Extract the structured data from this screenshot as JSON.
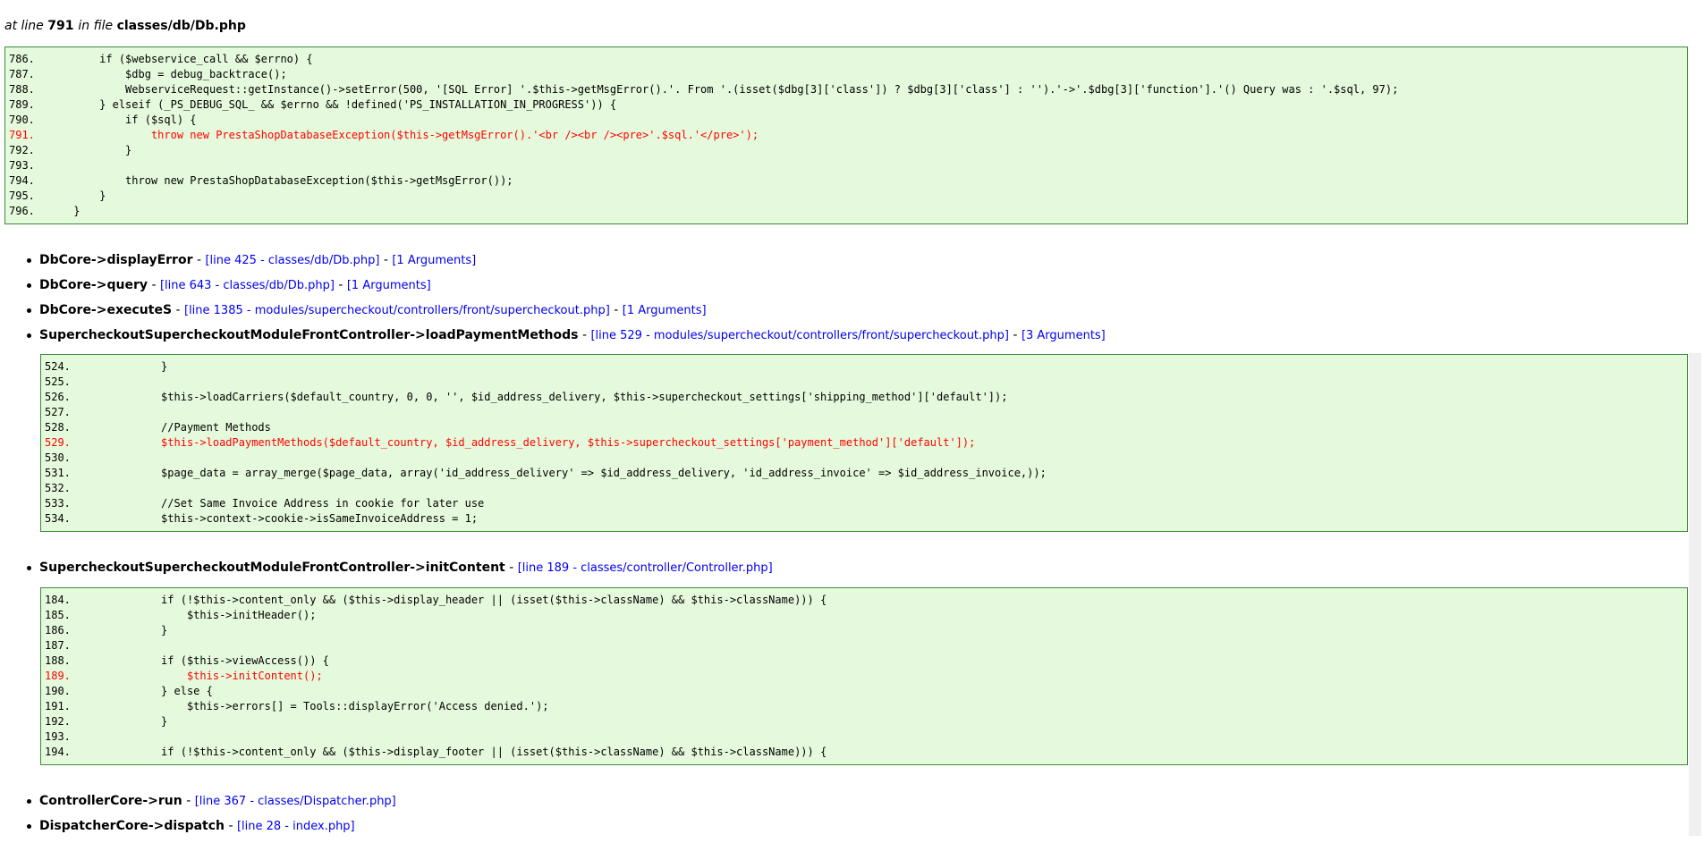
{
  "header": {
    "at_line_prefix": "at line",
    "line_number": "791",
    "in_file_label": "in file",
    "file_path": "classes/db/Db.php"
  },
  "main_code": {
    "lines": [
      {
        "num": "786.",
        "code": "        if ($webservice_call && $errno) {",
        "hl": false
      },
      {
        "num": "787.",
        "code": "            $dbg = debug_backtrace();",
        "hl": false
      },
      {
        "num": "788.",
        "code": "            WebserviceRequest::getInstance()->setError(500, '[SQL Error] '.$this->getMsgError().'. From '.(isset($dbg[3]['class']) ? $dbg[3]['class'] : '').'->'.$dbg[3]['function'].'() Query was : '.$sql, 97);",
        "hl": false
      },
      {
        "num": "789.",
        "code": "        } elseif (_PS_DEBUG_SQL_ && $errno && !defined('PS_INSTALLATION_IN_PROGRESS')) {",
        "hl": false
      },
      {
        "num": "790.",
        "code": "            if ($sql) {",
        "hl": false
      },
      {
        "num": "791.",
        "code": "                throw new PrestaShopDatabaseException($this->getMsgError().'<br /><br /><pre>'.$sql.'</pre>');",
        "hl": true
      },
      {
        "num": "792.",
        "code": "            }",
        "hl": false
      },
      {
        "num": "793.",
        "code": "",
        "hl": false
      },
      {
        "num": "794.",
        "code": "            throw new PrestaShopDatabaseException($this->getMsgError());",
        "hl": false
      },
      {
        "num": "795.",
        "code": "        }",
        "hl": false
      },
      {
        "num": "796.",
        "code": "    }",
        "hl": false
      }
    ]
  },
  "stack1": [
    {
      "fn": "DbCore->displayError",
      "file_link": "[line 425 - classes/db/Db.php]",
      "args_link": "[1 Arguments]"
    },
    {
      "fn": "DbCore->query",
      "file_link": "[line 643 - classes/db/Db.php]",
      "args_link": "[1 Arguments]"
    },
    {
      "fn": "DbCore->executeS",
      "file_link": "[line 1385 - modules/supercheckout/controllers/front/supercheckout.php]",
      "args_link": "[1 Arguments]"
    },
    {
      "fn": "SupercheckoutSupercheckoutModuleFrontController->loadPaymentMethods",
      "file_link": "[line 529 - modules/supercheckout/controllers/front/supercheckout.php]",
      "args_link": "[3 Arguments]"
    }
  ],
  "code2": {
    "lines": [
      {
        "num": "524.",
        "code": "            }",
        "hl": false
      },
      {
        "num": "525.",
        "code": "",
        "hl": false
      },
      {
        "num": "526.",
        "code": "            $this->loadCarriers($default_country, 0, 0, '', $id_address_delivery, $this->supercheckout_settings['shipping_method']['default']);",
        "hl": false
      },
      {
        "num": "527.",
        "code": "",
        "hl": false
      },
      {
        "num": "528.",
        "code": "            //Payment Methods",
        "hl": false
      },
      {
        "num": "529.",
        "code": "            $this->loadPaymentMethods($default_country, $id_address_delivery, $this->supercheckout_settings['payment_method']['default']);",
        "hl": true
      },
      {
        "num": "530.",
        "code": "",
        "hl": false
      },
      {
        "num": "531.",
        "code": "            $page_data = array_merge($page_data, array('id_address_delivery' => $id_address_delivery, 'id_address_invoice' => $id_address_invoice,));",
        "hl": false
      },
      {
        "num": "532.",
        "code": "",
        "hl": false
      },
      {
        "num": "533.",
        "code": "            //Set Same Invoice Address in cookie for later use",
        "hl": false
      },
      {
        "num": "534.",
        "code": "            $this->context->cookie->isSameInvoiceAddress = 1;",
        "hl": false
      }
    ]
  },
  "stack2": [
    {
      "fn": "SupercheckoutSupercheckoutModuleFrontController->initContent",
      "file_link": "[line 189 - classes/controller/Controller.php]"
    }
  ],
  "code3": {
    "lines": [
      {
        "num": "184.",
        "code": "            if (!$this->content_only && ($this->display_header || (isset($this->className) && $this->className))) {",
        "hl": false
      },
      {
        "num": "185.",
        "code": "                $this->initHeader();",
        "hl": false
      },
      {
        "num": "186.",
        "code": "            }",
        "hl": false
      },
      {
        "num": "187.",
        "code": "",
        "hl": false
      },
      {
        "num": "188.",
        "code": "            if ($this->viewAccess()) {",
        "hl": false
      },
      {
        "num": "189.",
        "code": "                $this->initContent();",
        "hl": true
      },
      {
        "num": "190.",
        "code": "            } else {",
        "hl": false
      },
      {
        "num": "191.",
        "code": "                $this->errors[] = Tools::displayError('Access denied.');",
        "hl": false
      },
      {
        "num": "192.",
        "code": "            }",
        "hl": false
      },
      {
        "num": "193.",
        "code": "",
        "hl": false
      },
      {
        "num": "194.",
        "code": "            if (!$this->content_only && ($this->display_footer || (isset($this->className) && $this->className))) {",
        "hl": false
      }
    ]
  },
  "stack3": [
    {
      "fn": "ControllerCore->run",
      "file_link": "[line 367 - classes/Dispatcher.php]"
    },
    {
      "fn": "DispatcherCore->dispatch",
      "file_link": "[line 28 - index.php]"
    }
  ]
}
